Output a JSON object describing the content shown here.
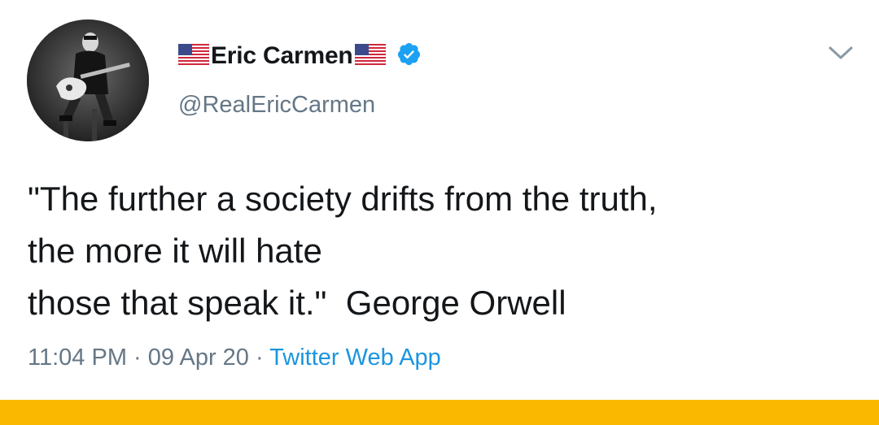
{
  "colors": {
    "text_primary": "#14171a",
    "text_secondary": "#657786",
    "link_blue": "#1b95e0",
    "verified_blue": "#1da1f2",
    "bottom_bar": "#fbb800"
  },
  "author": {
    "avatar_icon": "profile-photo-guitarist",
    "flag_icon": "us-flag-emoji",
    "display_name": "Eric Carmen",
    "handle": "@RealEricCarmen",
    "verified_icon": "verified-badge-icon"
  },
  "menu": {
    "chevron_icon": "chevron-down-icon"
  },
  "tweet": {
    "lines": [
      "\"The further a society drifts from the truth,",
      "the more it will hate",
      "those that speak it.\"  George Orwell"
    ],
    "time": "11:04 PM",
    "separator": " · ",
    "date": "09 Apr 20",
    "source": "Twitter Web App"
  }
}
